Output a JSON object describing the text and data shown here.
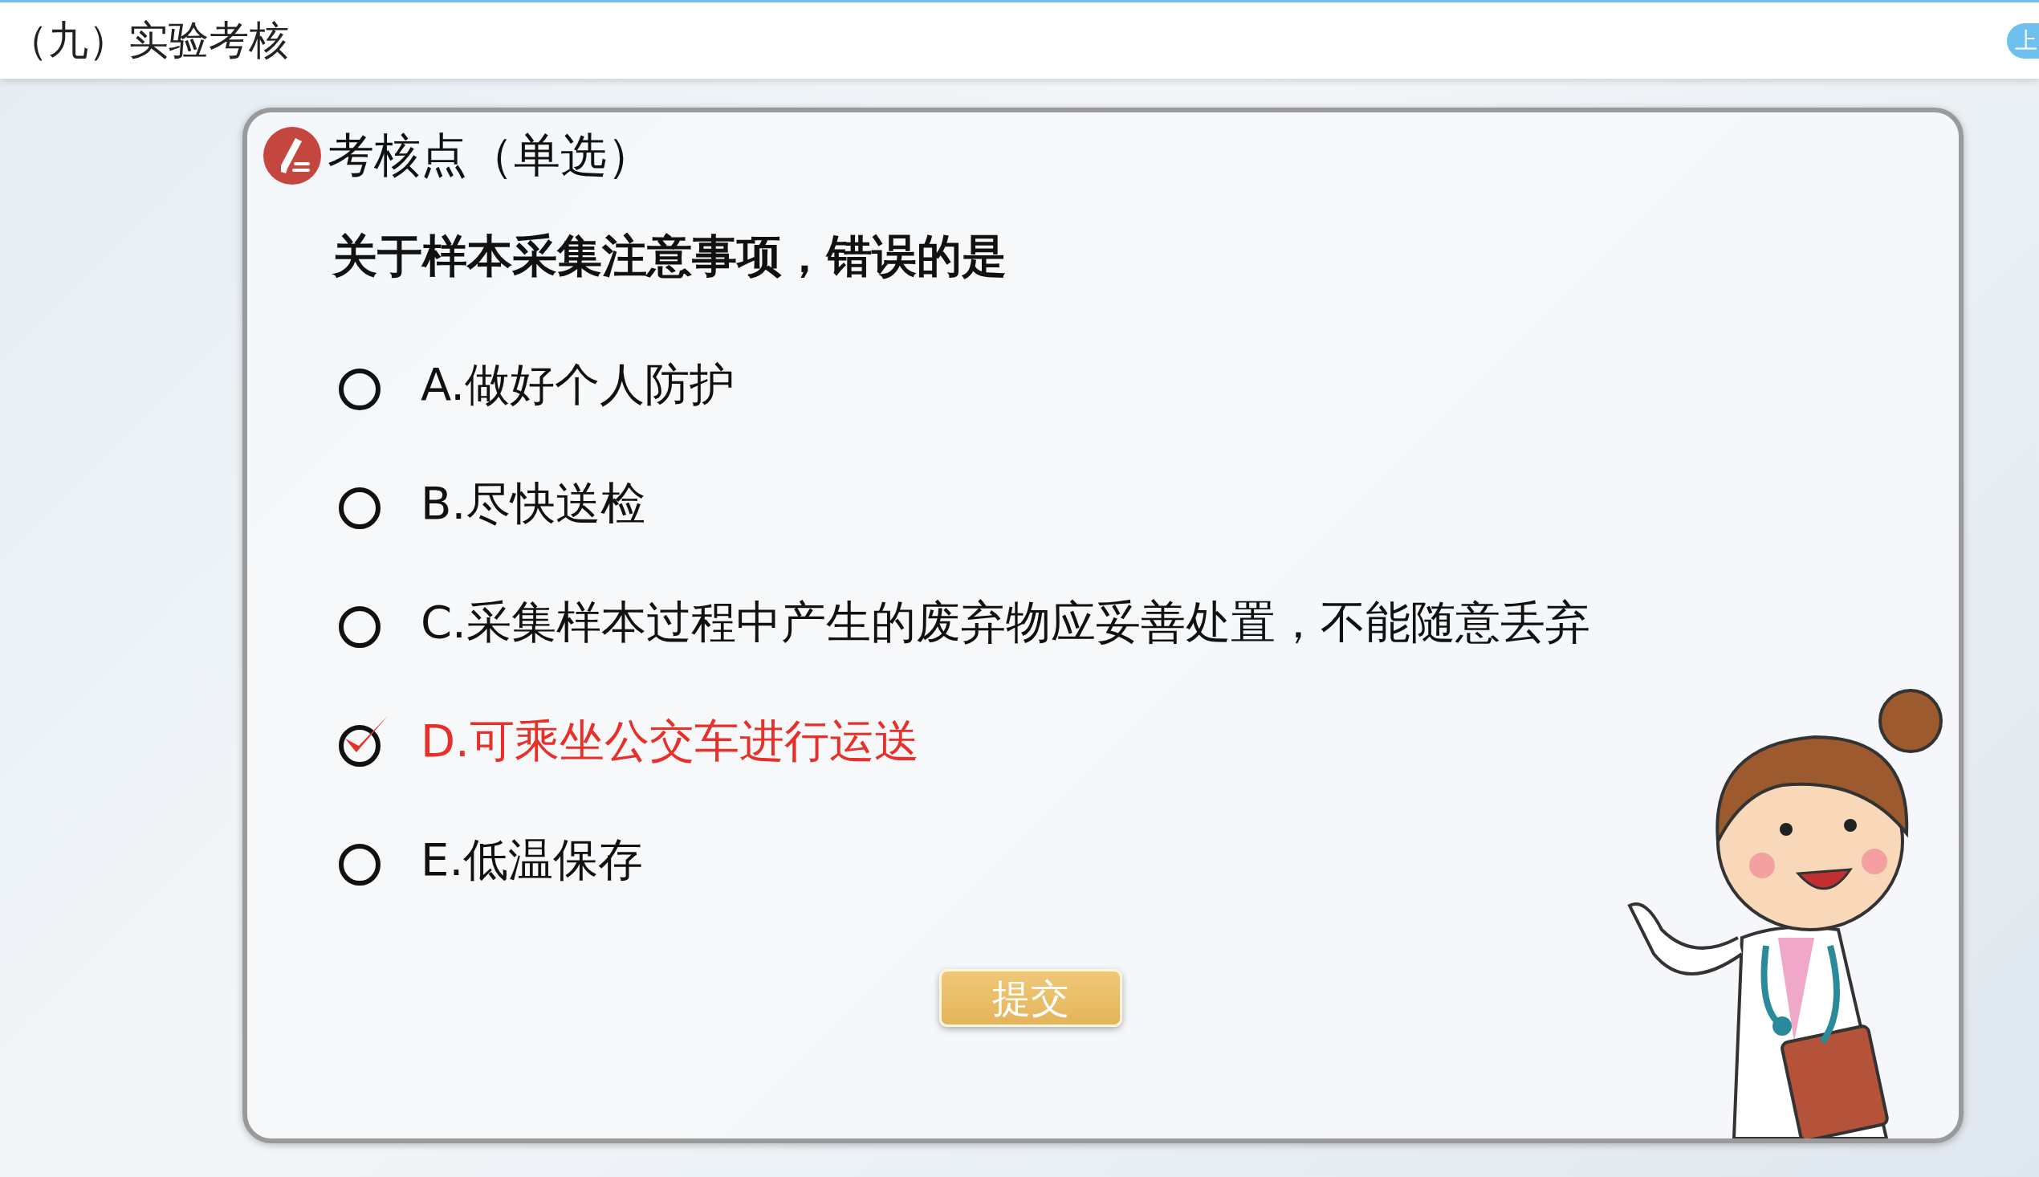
{
  "header": {
    "title": "（九）实验考核",
    "side_button": "上"
  },
  "question": {
    "heading": "考核点（单选）",
    "stem": "关于样本采集注意事项，错误的是",
    "options": [
      {
        "label": "A.做好个人防护",
        "selected": false
      },
      {
        "label": "B.尽快送检",
        "selected": false
      },
      {
        "label": "C.采集样本过程中产生的废弃物应妥善处置，不能随意丢弃",
        "selected": false
      },
      {
        "label": "D.可乘坐公交车进行运送",
        "selected": true
      },
      {
        "label": "E.低温保存",
        "selected": false
      }
    ],
    "submit": "提交"
  }
}
